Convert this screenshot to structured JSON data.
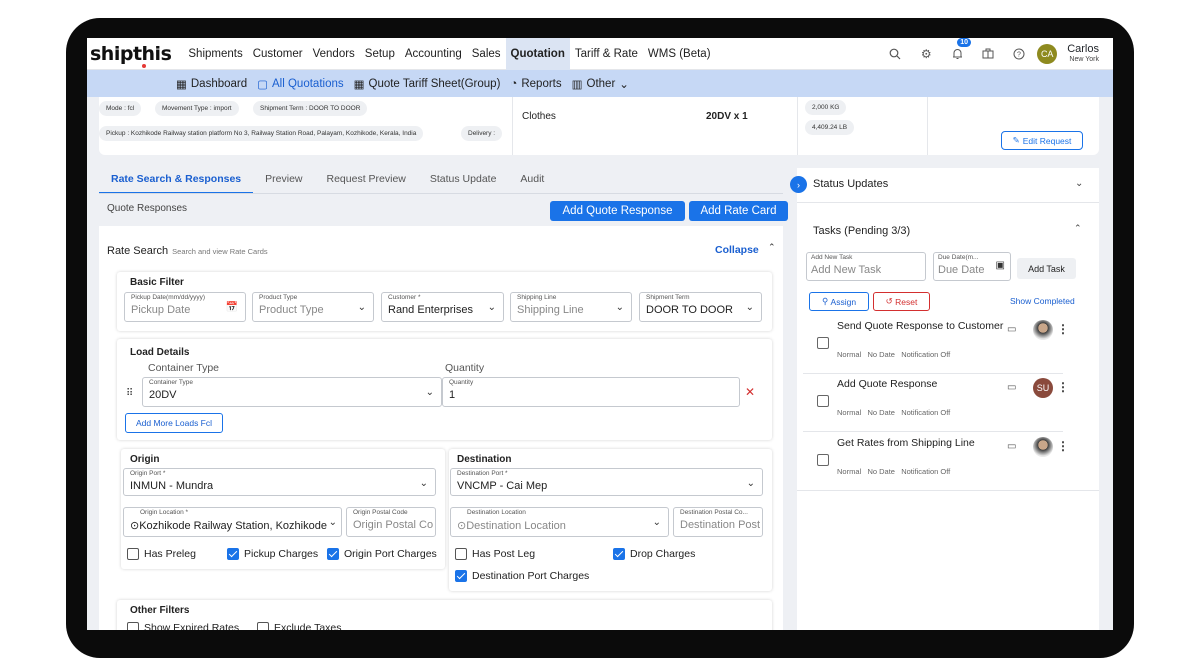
{
  "brand": {
    "logo": "shipthis"
  },
  "nav": {
    "items": [
      "Shipments",
      "Customer",
      "Vendors",
      "Setup",
      "Accounting",
      "Sales",
      "Quotation",
      "Tariff & Rate",
      "WMS (Beta)"
    ],
    "active": "Quotation"
  },
  "notifications": {
    "count": "10"
  },
  "user": {
    "initials": "CA",
    "name": "Carlos",
    "location": "New York"
  },
  "subnav": {
    "items": [
      "Dashboard",
      "All Quotations",
      "Quote Tariff Sheet(Group)",
      "Reports",
      "Other"
    ],
    "active": "All Quotations"
  },
  "request": {
    "mode": "Mode : fcl",
    "movement": "Movement Type : import",
    "term": "Shipment Term : DOOR TO DOOR",
    "pickup": "Pickup : Kozhikode Railway station platform No 3, Railway Station Road, Palayam, Kozhikode, Kerala, India",
    "delivery": "Delivery :",
    "commodity": "Clothes",
    "containers": "20DV x 1",
    "weight_kg": "2,000 KG",
    "weight_lb": "4,409.24 LB",
    "edit_label": "Edit Request"
  },
  "tabs": [
    "Rate Search & Responses",
    "Preview",
    "Request Preview",
    "Status Update",
    "Audit"
  ],
  "quote_responses": {
    "label": "Quote Responses",
    "add_quote": "Add Quote Response",
    "add_rate": "Add Rate Card"
  },
  "rate_search": {
    "title": "Rate Search",
    "subtitle": "Search and view Rate Cards",
    "collapse": "Collapse"
  },
  "basic_filter": {
    "title": "Basic Filter",
    "pickup": {
      "label": "Pickup Date(mm/dd/yyyy)",
      "placeholder": "Pickup Date"
    },
    "product": {
      "label": "Product Type",
      "placeholder": "Product Type"
    },
    "customer": {
      "label": "Customer *",
      "value": "Rand Enterprises"
    },
    "line": {
      "label": "Shipping Line",
      "placeholder": "Shipping Line"
    },
    "term": {
      "label": "Shipment Term",
      "value": "DOOR TO DOOR"
    }
  },
  "load": {
    "title": "Load Details",
    "col_container": "Container Type",
    "col_qty": "Quantity",
    "container": {
      "label": "Container Type",
      "value": "20DV"
    },
    "qty": {
      "label": "Quantity",
      "value": "1"
    },
    "add_more": "Add More Loads Fcl"
  },
  "origin": {
    "title": "Origin",
    "port_label": "Origin Port *",
    "port": "INMUN - Mundra",
    "loc_label": "Origin Location *",
    "loc": "Kozhikode Railway Station, Kozhikode Ra",
    "postal_label": "Origin Postal Code",
    "postal_ph": "Origin Postal Code",
    "checks": [
      {
        "label": "Has Preleg",
        "checked": false
      },
      {
        "label": "Pickup Charges",
        "checked": true
      },
      {
        "label": "Origin Port Charges",
        "checked": true
      }
    ]
  },
  "destination": {
    "title": "Destination",
    "port_label": "Destination Port *",
    "port": "VNCMP - Cai Mep",
    "loc_label": "Destination Location",
    "loc_ph": "Destination Location",
    "postal_label": "Destination Postal Co...",
    "postal_ph": "Destination Postal Code",
    "checks": [
      {
        "label": "Has Post Leg",
        "checked": false
      },
      {
        "label": "Drop Charges",
        "checked": true
      },
      {
        "label": "Destination Port Charges",
        "checked": true
      }
    ]
  },
  "other_filters": {
    "title": "Other Filters",
    "checks": [
      "Show Expired Rates",
      "Exclude Taxes"
    ]
  },
  "sidebar": {
    "status_title": "Status Updates",
    "tasks_title": "Tasks (Pending 3/3)",
    "new_task": {
      "label": "Add New Task",
      "placeholder": "Add New Task"
    },
    "due": {
      "label": "Due Date(m...",
      "placeholder": "Due Date"
    },
    "add_task": "Add Task",
    "assign": "Assign",
    "reset": "Reset",
    "show_completed": "Show Completed",
    "tasks": [
      {
        "title": "Send Quote Response to Customer",
        "priority": "Normal",
        "date": "No Date",
        "notif": "Notification Off",
        "avatar": "photo"
      },
      {
        "title": "Add Quote Response",
        "priority": "Normal",
        "date": "No Date",
        "notif": "Notification Off",
        "avatar": "SU"
      },
      {
        "title": "Get Rates from Shipping Line",
        "priority": "Normal",
        "date": "No Date",
        "notif": "Notification Off",
        "avatar": "photo"
      }
    ]
  },
  "colors": {
    "accent": "#1a73e8",
    "subnav": "#c6d8f5",
    "reset": "#d32f2f",
    "avatar_ca": "#8e8a1f",
    "avatar_su": "#8a4a3c"
  }
}
